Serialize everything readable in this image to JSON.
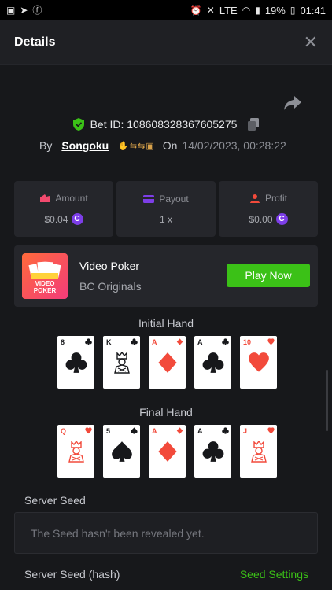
{
  "status_bar": {
    "battery": "19%",
    "time": "01:41",
    "network": "LTE"
  },
  "header": {
    "title": "Details"
  },
  "bet": {
    "id_text": "Bet ID: 108608328367605275",
    "by_label": "By",
    "username": "Songoku",
    "on_label": "On",
    "date": "14/02/2023, 00:28:22"
  },
  "stats": [
    {
      "label": "Amount",
      "value": "$0.04",
      "icon": "wallet-icon",
      "color": "#f24a6e"
    },
    {
      "label": "Payout",
      "value": "1 x",
      "icon": "payout-card-icon",
      "color": "#7d3ee8"
    },
    {
      "label": "Profit",
      "value": "$0.00",
      "icon": "profit-icon",
      "color": "#f24a3b"
    }
  ],
  "game": {
    "name": "Video Poker",
    "provider": "BC Originals",
    "thumb_label": "VIDEO POKER",
    "play_label": "Play Now"
  },
  "initial_hand": {
    "title": "Initial Hand",
    "cards": [
      {
        "rank": "8",
        "suit": "clubs"
      },
      {
        "rank": "K",
        "suit": "clubs"
      },
      {
        "rank": "A",
        "suit": "diamonds"
      },
      {
        "rank": "A",
        "suit": "clubs"
      },
      {
        "rank": "10",
        "suit": "hearts"
      }
    ]
  },
  "final_hand": {
    "title": "Final Hand",
    "cards": [
      {
        "rank": "Q",
        "suit": "hearts"
      },
      {
        "rank": "5",
        "suit": "spades"
      },
      {
        "rank": "A",
        "suit": "diamonds"
      },
      {
        "rank": "A",
        "suit": "clubs"
      },
      {
        "rank": "J",
        "suit": "hearts"
      }
    ]
  },
  "server_seed": {
    "label": "Server Seed",
    "value": "The Seed hasn't been revealed yet."
  },
  "server_seed_hash": {
    "label": "Server Seed (hash)",
    "settings_label": "Seed Settings"
  }
}
